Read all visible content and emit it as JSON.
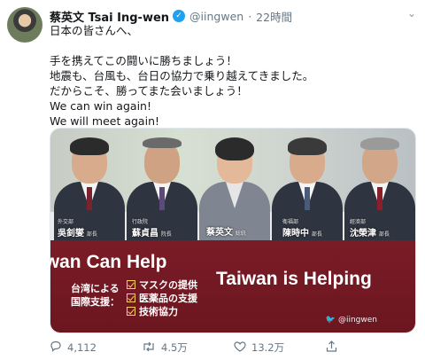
{
  "tweet": {
    "display_name": "蔡英文 Tsai Ing-wen",
    "handle": "@iingwen",
    "separator": "·",
    "timestamp": "22時間",
    "verified": true,
    "lines": [
      "日本の皆さんへ、",
      "",
      "手を携えてこの闘いに勝ちましょう！",
      "地震も、台風も、台日の協力で乗り越えてきました。",
      "だからこそ、勝ってまた会いましょう！",
      "We can win again!",
      "We will meet again!"
    ]
  },
  "media": {
    "people": [
      {
        "role": "外交部",
        "name": "吳釗燮",
        "suffix": "部長"
      },
      {
        "role": "行政院",
        "name": "蘇貞昌",
        "suffix": "院長"
      },
      {
        "role": "",
        "name": "蔡英文",
        "suffix": "総統"
      },
      {
        "role": "衛福部",
        "name": "陳時中",
        "suffix": "部長"
      },
      {
        "role": "經濟部",
        "name": "沈榮津",
        "suffix": "部長"
      }
    ],
    "slogan_1": "Taiwan Can Help",
    "slogan_2": "Taiwan is Helping",
    "support_title_1": "台湾による",
    "support_title_2": "国際支援：",
    "support_items": [
      "マスクの提供",
      "医薬品の支援",
      "技術協力"
    ],
    "watermark": "@iingwen"
  },
  "actions": {
    "reply_count": "4,112",
    "retweet_count": "4.5万",
    "like_count": "13.2万"
  },
  "colors": {
    "verified": "#1da1f2",
    "banner_red": "#7a1c26",
    "muted_text": "#657786"
  }
}
